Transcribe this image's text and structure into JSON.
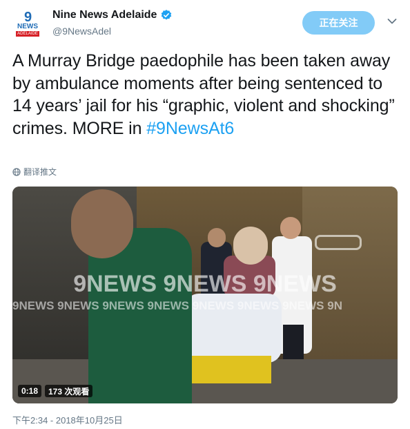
{
  "account": {
    "display_name": "Nine News Adelaide",
    "handle": "@9NewsAdel",
    "verified": true,
    "avatar": {
      "nine": "9",
      "news": "NEWS",
      "city": "ADELAIDE"
    }
  },
  "follow_button": {
    "label": "正在关注"
  },
  "menu": {
    "icon": "chevron-down-icon"
  },
  "tweet": {
    "text": "A Murray Bridge paedophile has been taken away by ambulance moments after being sentenced to 14 years’ jail for his “graphic, violent and shocking” crimes. MORE in ",
    "hashtag": "#9NewsAt6",
    "translate_label": "翻译推文",
    "timestamp": "下午2:34 - 2018年10月25日"
  },
  "video": {
    "duration": "0:18",
    "views": "173 次观看",
    "watermark_large": "9NEWS 9NEWS 9NEWS",
    "watermark_small": "9NEWS 9NEWS 9NEWS 9NEWS 9NEWS 9NEWS 9NEWS 9N"
  },
  "colors": {
    "accent": "#1da1f2",
    "text": "#14171a",
    "secondary": "#657786"
  }
}
